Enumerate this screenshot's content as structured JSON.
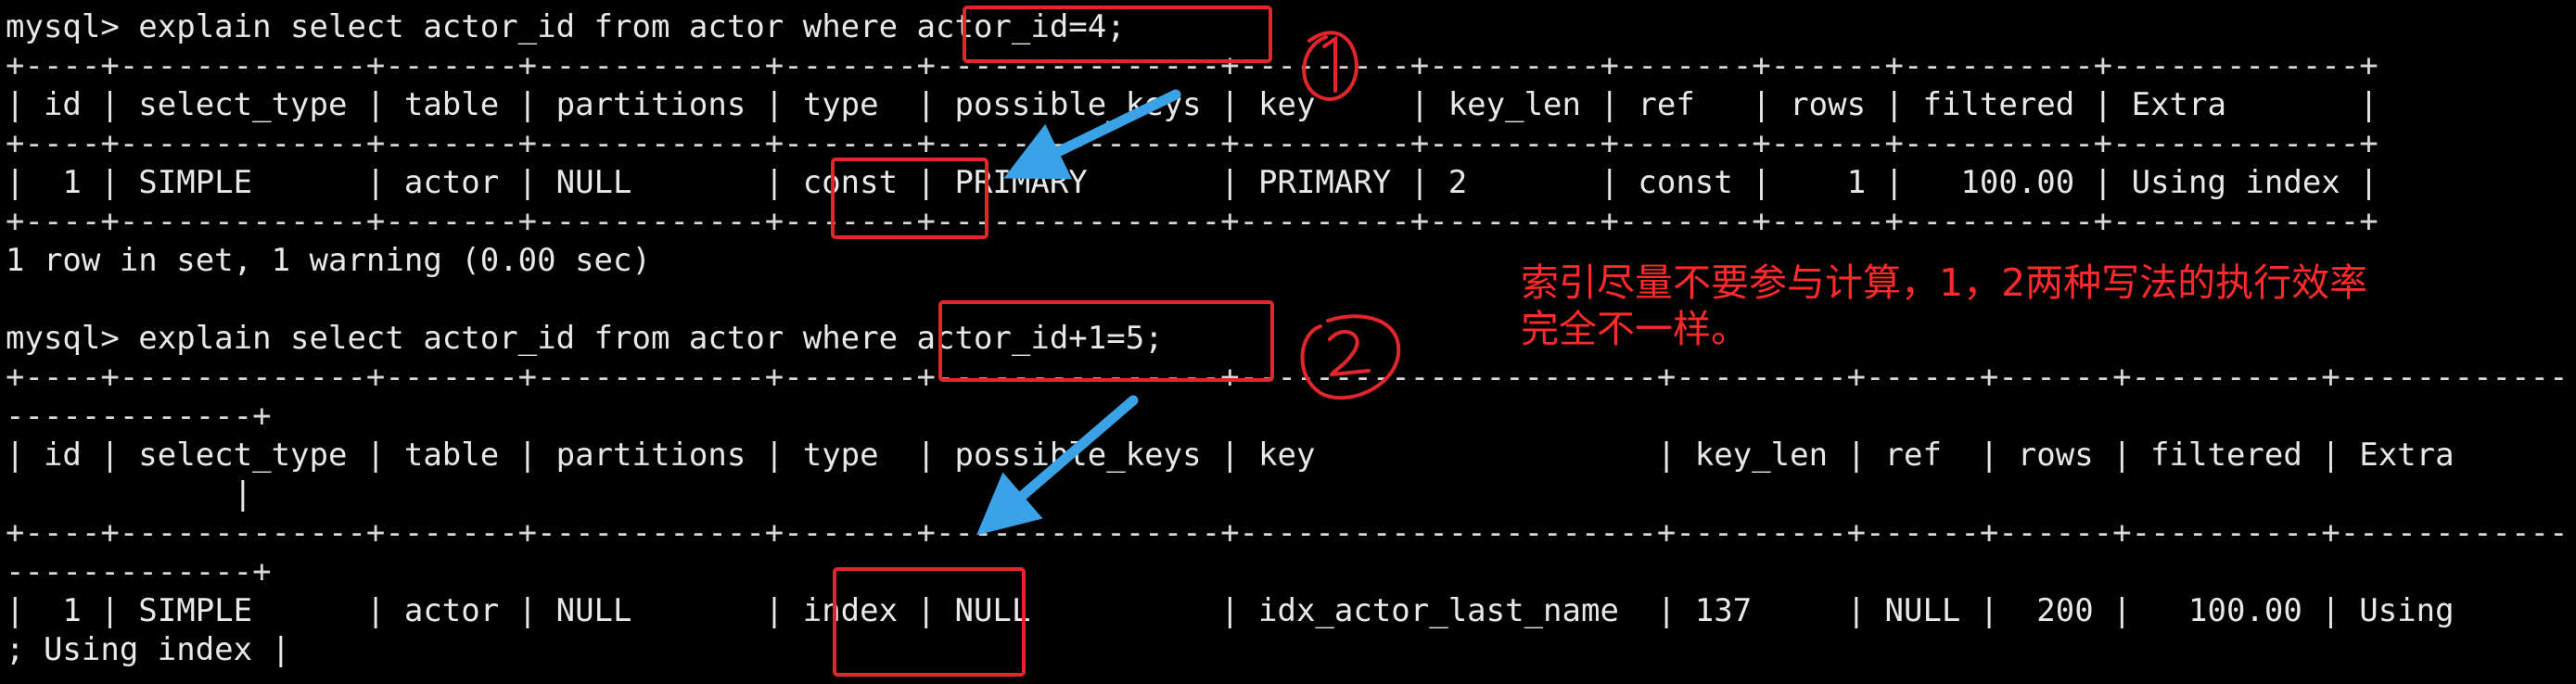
{
  "terminal": {
    "lines": [
      "mysql> explain select actor_id from actor where actor_id=4;",
      "+----+-------------+-------+------------+-------+---------------+---------+---------+-------+------+----------+-------------+",
      "| id | select_type | table | partitions | type  | possible_keys | key     | key_len | ref   | rows | filtered | Extra       |",
      "+----+-------------+-------+------------+-------+---------------+---------+---------+-------+------+----------+-------------+",
      "|  1 | SIMPLE      | actor | NULL       | const | PRIMARY       | PRIMARY | 2       | const |    1 |   100.00 | Using index |",
      "+----+-------------+-------+------------+-------+---------------+---------+---------+-------+------+----------+-------------+",
      "1 row in set, 1 warning (0.00 sec)",
      "",
      "mysql> explain select actor_id from actor where actor_id+1=5;",
      "+----+-------------+-------+------------+-------+---------------+----------------------+---------+------+------+----------+------------",
      "-------------+",
      "| id | select_type | table | partitions | type  | possible_keys | key                  | key_len | ref  | rows | filtered | Extra",
      "            |",
      "+----+-------------+-------+------------+-------+---------------+----------------------+---------+------+------+----------+------------",
      "-------------+",
      "|  1 | SIMPLE      | actor | NULL       | index | NULL          | idx_actor_last_name  | 137     | NULL |  200 |   100.00 | Using",
      "; Using index |"
    ]
  },
  "annotation": {
    "note_lines": [
      "索引尽量不要参与计算，1，2两种写法的执行效率",
      "完全不一样。"
    ],
    "marker_1": "①",
    "marker_2": "②",
    "color": "#e3262b",
    "arrow_color": "#3aa3e8"
  }
}
